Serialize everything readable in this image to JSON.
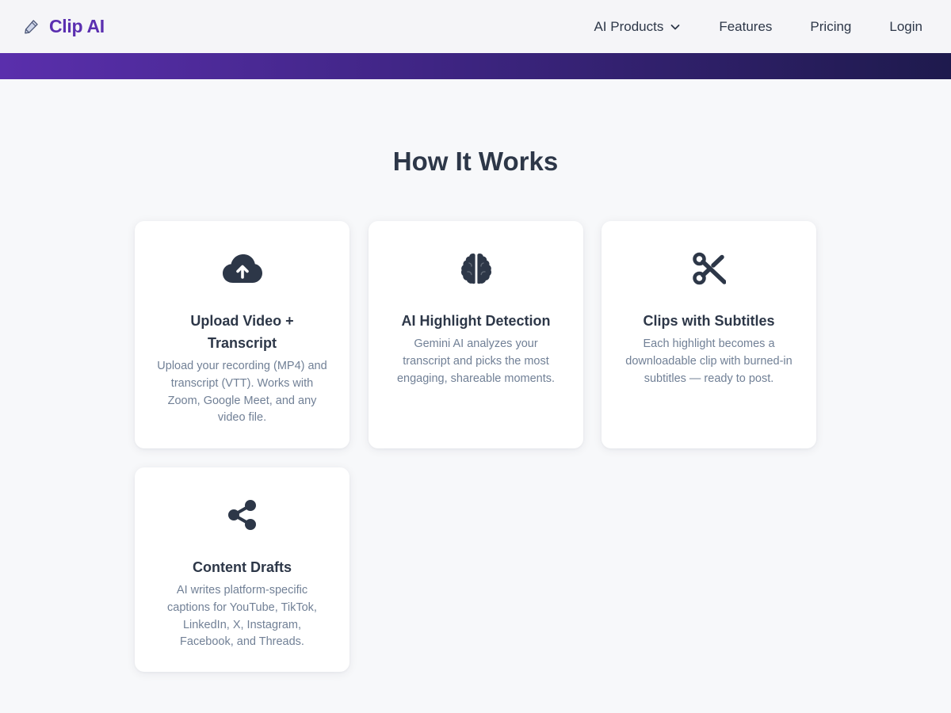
{
  "brand": {
    "name": "Clip AI",
    "icon": "pen-icon",
    "color": "#5b2fb0"
  },
  "nav": {
    "items": [
      {
        "label": "AI Products",
        "has_dropdown": true
      },
      {
        "label": "Features"
      },
      {
        "label": "Pricing"
      },
      {
        "label": "Login"
      }
    ]
  },
  "header_gradient": [
    "#5a2fac",
    "#1e1a4d"
  ],
  "main": {
    "title": "How It Works",
    "cards": [
      {
        "icon": "cloud-upload-icon",
        "title": "Upload Video + Transcript",
        "description": "Upload your recording (MP4) and transcript (VTT). Works with Zoom, Google Meet, and any video file."
      },
      {
        "icon": "brain-icon",
        "title": "AI Highlight Detection",
        "description": "Gemini AI analyzes your transcript and picks the most engaging, shareable moments."
      },
      {
        "icon": "scissors-icon",
        "title": "Clips with Subtitles",
        "description": "Each highlight becomes a downloadable clip with burned-in subtitles — ready to post."
      },
      {
        "icon": "share-icon",
        "title": "Content Drafts",
        "description": "AI writes platform-specific captions for YouTube, TikTok, LinkedIn, X, Instagram, Facebook, and Threads."
      }
    ]
  },
  "colors": {
    "text": "#2d3748",
    "muted": "#718096",
    "background": "#f7f8fa"
  }
}
